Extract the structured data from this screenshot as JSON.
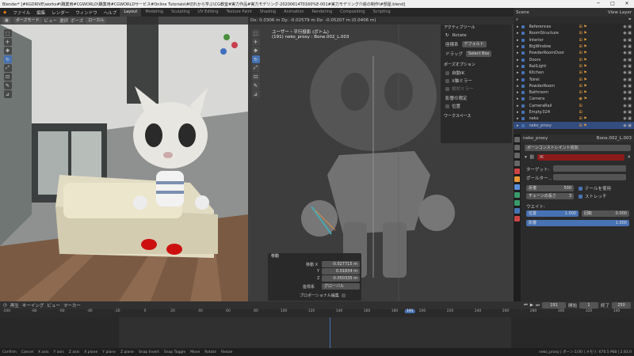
{
  "window": {
    "title": "Blender* [#KGDRIVE\\works#\\職業用#CGWORLD\\職業用#CGWORLDサービス#Online Tutorials\\#切れから学ぶ\\CG教室#実力作品#実力モデリング-20200614T0160%E-001#実力モデリング介絵の制作\\#部屋.blend]",
    "controls": [
      "─",
      "□",
      "✕"
    ]
  },
  "menu": {
    "items": [
      "ファイル",
      "編集",
      "レンダー",
      "ウィンドウ",
      "ヘルプ"
    ],
    "workspaces": [
      "Layout",
      "Modeling",
      "Sculpting",
      "UV Editing",
      "Texture Paint",
      "Shading",
      "Animation",
      "Rendering",
      "Compositing",
      "Scripting"
    ],
    "active_workspace": "Layout",
    "scene": "Scene",
    "view_layer": "View Layer"
  },
  "left_viewport": {
    "mode": "ポーズモード",
    "menus": [
      "ビュー",
      "選択",
      "ポーズ"
    ],
    "orientation": "ローカル"
  },
  "right_viewport": {
    "header_text": "Dx: 0.0306 m  Dy: -0.02579 m  Dz: -0.05207 m (0.0406 m)",
    "view_title": "ユーザー・平行投影 (ボトム)",
    "object_info": "(191) neko_proxy : Bone.002_L.003",
    "active_tool_title": "アクティブツール",
    "tool_name": "Rotate",
    "transform_label": "座標系",
    "transform_value": "デフォルト",
    "drag_label": "ドラッグ",
    "drag_value": "Select Box",
    "pose_options_title": "ポーズオプション",
    "auto_ik": "自動IK",
    "x_mirror": "X軸ミラー",
    "relative_mirror": "相対ミラー",
    "affect_only_title": "影響の限定",
    "affect_location": "位置",
    "workspace_title": "ワークスペース"
  },
  "operator_panel": {
    "title": "移動",
    "move_label": "移動 X",
    "values": [
      "-0.027715 m",
      "0.01834 m",
      "-0.050335 m"
    ],
    "axes": [
      "X",
      "Y",
      "Z"
    ],
    "orientation_label": "座標系",
    "orientation_value": "グローバル",
    "proportional": "プロポーショナル編集"
  },
  "outliner": {
    "rows": [
      {
        "name": "References",
        "icons": "⊞ ⚑"
      },
      {
        "name": "RoomStructure",
        "icons": "⊞ ⚑"
      },
      {
        "name": "Interior",
        "icons": "⊞ ⚑"
      },
      {
        "name": "BigWindow",
        "icons": "⊞ ⚑"
      },
      {
        "name": "PowderRoomDoor",
        "icons": "⊞ ⚑"
      },
      {
        "name": "Doors",
        "icons": "⊞ ⚑"
      },
      {
        "name": "RailLight",
        "icons": "⊞ ⚑"
      },
      {
        "name": "Kitchen",
        "icons": "⊞ ⚑"
      },
      {
        "name": "Toirei",
        "icons": "⊞ ⚑"
      },
      {
        "name": "PowderRoom",
        "icons": "⊞ ⚑"
      },
      {
        "name": "Bathroom",
        "icons": "⊞ ⚑"
      },
      {
        "name": "Camera",
        "icons": "◉ ⚑"
      },
      {
        "name": "CameraRail",
        "icons": "⊞"
      },
      {
        "name": "Empty.024",
        "icons": "⊞"
      },
      {
        "name": "neko",
        "icons": "⊞ ⚑"
      },
      {
        "name": "neko_proxy",
        "icons": "⊞ ⚑"
      }
    ]
  },
  "properties": {
    "object_name": "neko_proxy",
    "bone_name": "Bone.002_L.003",
    "section_title": "ボーンコンストレイント追加",
    "constraint_name": "IK",
    "target_label": "ターゲット:",
    "pole_label": "ポールター...",
    "iterations_label": "反復",
    "iterations_value": "500",
    "chain_label": "チェーンの長さ",
    "chain_value": "3",
    "use_tail": "テールを使用",
    "stretch": "ストレッチ",
    "weight_title": "ウエイト:",
    "weight_position": "位置",
    "weight_position_value": "1.000",
    "rotation_label": "回転",
    "rotation_value": "0.000",
    "influence_label": "影響",
    "influence_value": "1.000"
  },
  "timeline": {
    "menus": [
      "再生",
      "キーイング",
      "ビュー",
      "マーカー"
    ],
    "current_frame": "191",
    "start_label": "開始",
    "start": "1",
    "end_label": "終了",
    "end": "250",
    "ticks": [
      "-100",
      "-80",
      "-60",
      "-40",
      "-20",
      "0",
      "20",
      "40",
      "60",
      "80",
      "100",
      "120",
      "140",
      "160",
      "180",
      "191",
      "200",
      "220",
      "240",
      "260",
      "280",
      "300",
      "320",
      "340"
    ]
  },
  "statusbar": {
    "items": [
      "Confirm",
      "Cancel",
      "X axis",
      "Y axis",
      "Z axis",
      "X plane",
      "Y plane",
      "Z plane",
      "Snap Invert",
      "Snap Toggle",
      "Move",
      "Rotate",
      "Resize"
    ],
    "right": "neko_proxy | ボーン:1/30 | メモリ: 670.5 MiB | 2.83.0"
  },
  "colors": {
    "accent": "#4772b3",
    "constraint_red": "#8b1a1a",
    "playhead": "#4772b3"
  }
}
